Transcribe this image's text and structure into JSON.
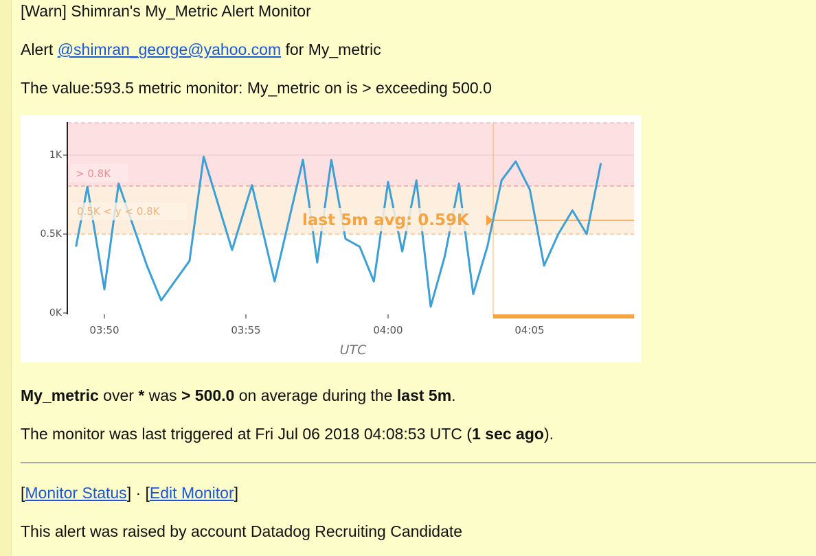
{
  "email": {
    "subject_line": "[Warn] Shimran's My_Metric Alert Monitor",
    "alert_prefix": "Alert",
    "alert_mention": "@shimran_george@yahoo.com",
    "alert_suffix": "for My_metric",
    "value_line": "The value:593.5 metric monitor: My_metric on is > exceeding 500.0",
    "summary": {
      "metric": "My_metric",
      "over": "over",
      "scope": "*",
      "was": "was",
      "condition": "> 500.0",
      "on_avg": "on average during the",
      "window": "last 5m",
      "period": "."
    },
    "triggered": {
      "prefix": "The monitor was last triggered at Fri Jul 06 2018 04:08:53 UTC (",
      "ago": "1 sec ago",
      "suffix": ")."
    },
    "links": {
      "open1": "[",
      "monitor_status": "Monitor Status",
      "close1": "]",
      "sep": " · ",
      "open2": "[",
      "edit_monitor": "Edit Monitor",
      "close2": "]"
    },
    "footer": "This alert was raised by account Datadog Recruiting Candidate"
  },
  "chart_data": {
    "type": "line",
    "xlabel": "UTC",
    "ylabel": "",
    "x_ticks": [
      "03:50",
      "03:55",
      "04:00",
      "04:05"
    ],
    "y_ticks": [
      "0K",
      "0.5K",
      "1K"
    ],
    "ylim": [
      0,
      1200
    ],
    "xlim_minutes": [
      -1.2,
      18.7
    ],
    "series": [
      {
        "color": "#3d9fd3",
        "x": [
          -1.0,
          -0.6,
          0.0,
          0.5,
          1.5,
          2.0,
          3.0,
          3.5,
          4.5,
          5.2,
          6.0,
          7.0,
          7.5,
          8.0,
          8.5,
          9.0,
          9.5,
          10.0,
          10.5,
          11.0,
          11.5,
          12.0,
          12.5,
          13.0,
          13.5,
          14.0,
          14.5,
          15.0,
          15.5,
          16.0,
          16.5,
          17.0,
          17.5
        ],
        "y": [
          420,
          800,
          150,
          820,
          300,
          80,
          330,
          990,
          400,
          810,
          200,
          970,
          320,
          970,
          470,
          420,
          200,
          830,
          390,
          840,
          40,
          360,
          820,
          120,
          420,
          840,
          960,
          780,
          300,
          500,
          650,
          500,
          950
        ]
      }
    ],
    "thresholds": [
      {
        "label": "> 0.8K",
        "value": 800,
        "color": "#f2a0a8"
      },
      {
        "label": "0.5K < y < 0.8K",
        "value": 500,
        "color": "#f3c59a"
      }
    ],
    "annotation": {
      "label": "last 5m avg: 0.59K",
      "value": 590,
      "color": "#f5a442"
    }
  }
}
